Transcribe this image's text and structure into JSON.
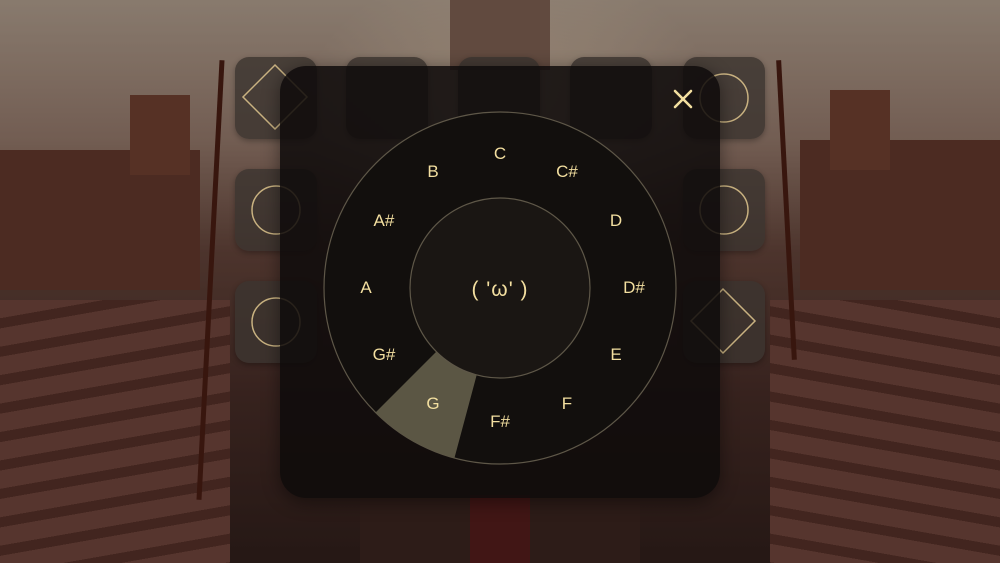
{
  "wheel": {
    "notes": [
      "C",
      "C#",
      "D",
      "D#",
      "E",
      "F",
      "F#",
      "G",
      "G#",
      "A",
      "A#",
      "B"
    ],
    "center_face": "( 'ω' )",
    "selected_note": "G"
  },
  "colors": {
    "accent": "#f3dfa0",
    "panel": "#0e0b0a",
    "ring_stroke": "#5e5748",
    "highlight": "#5b5644"
  },
  "icons": {
    "close": "close-icon",
    "diamond": "diamond-icon",
    "circle": "circle-icon"
  }
}
